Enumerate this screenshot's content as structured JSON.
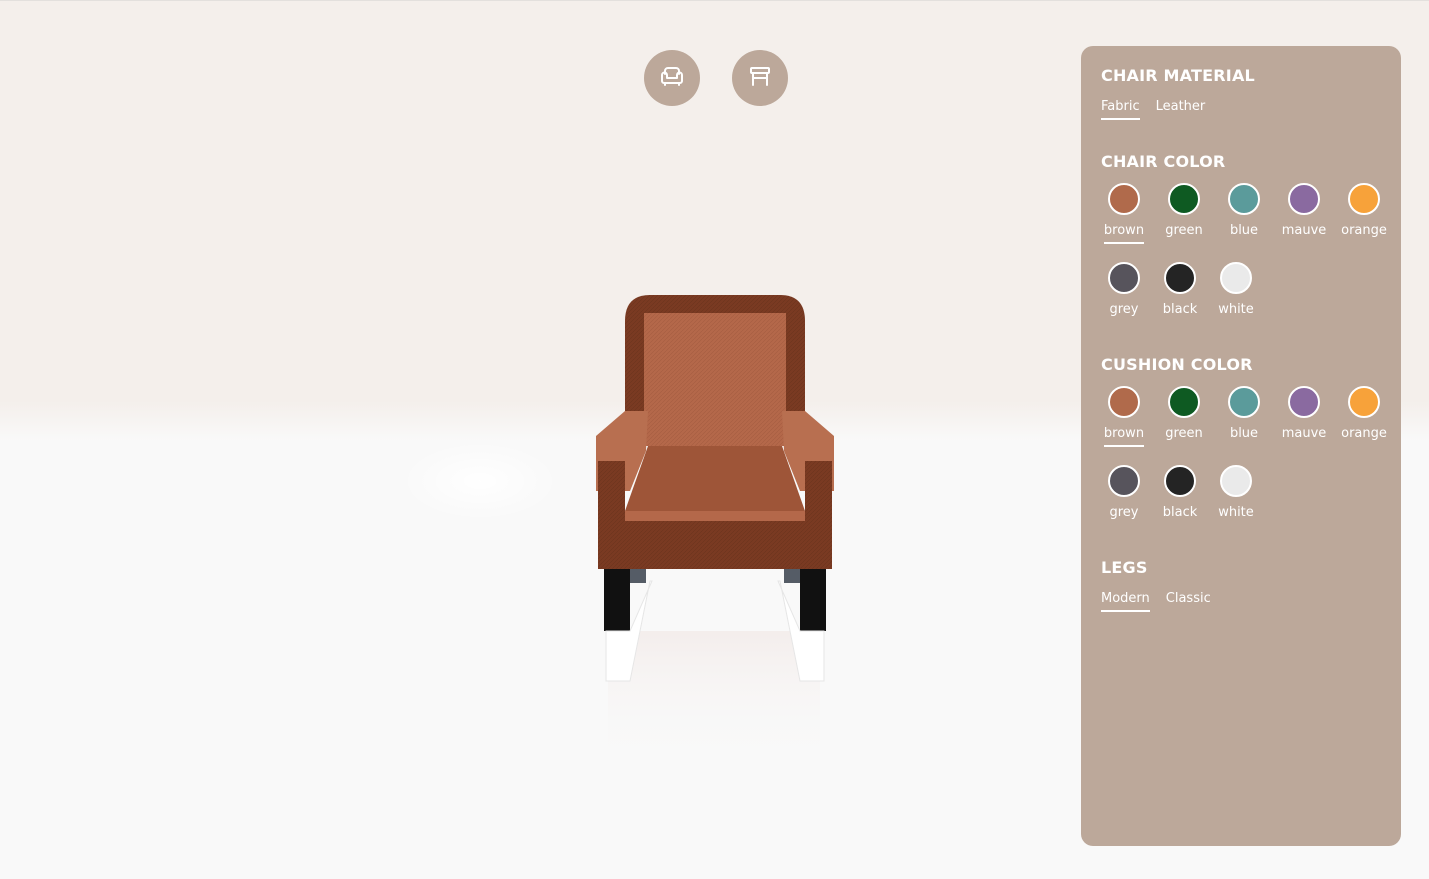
{
  "toolbar": {
    "buttons": [
      {
        "icon": "armchair-icon"
      },
      {
        "icon": "stool-icon"
      }
    ]
  },
  "panel": {
    "chair_material": {
      "title": "CHAIR MATERIAL",
      "options": [
        "Fabric",
        "Leather"
      ],
      "selected": "Fabric"
    },
    "chair_color": {
      "title": "CHAIR COLOR",
      "options": [
        {
          "label": "brown",
          "color": "#b06a4b"
        },
        {
          "label": "green",
          "color": "#0e5a22"
        },
        {
          "label": "blue",
          "color": "#5b9b9b"
        },
        {
          "label": "mauve",
          "color": "#8a6aa0"
        },
        {
          "label": "orange",
          "color": "#f7a23a"
        },
        {
          "label": "grey",
          "color": "#57545c"
        },
        {
          "label": "black",
          "color": "#242424"
        },
        {
          "label": "white",
          "color": "#eaeaea"
        }
      ],
      "selected": "brown"
    },
    "cushion_color": {
      "title": "CUSHION COLOR",
      "options": [
        {
          "label": "brown",
          "color": "#b06a4b"
        },
        {
          "label": "green",
          "color": "#0e5a22"
        },
        {
          "label": "blue",
          "color": "#5b9b9b"
        },
        {
          "label": "mauve",
          "color": "#8a6aa0"
        },
        {
          "label": "orange",
          "color": "#f7a23a"
        },
        {
          "label": "grey",
          "color": "#57545c"
        },
        {
          "label": "black",
          "color": "#242424"
        },
        {
          "label": "white",
          "color": "#eaeaea"
        }
      ],
      "selected": "brown"
    },
    "legs": {
      "title": "LEGS",
      "options": [
        "Modern",
        "Classic"
      ],
      "selected": "Modern"
    }
  },
  "colors": {
    "panel_bg": "#bca89a",
    "chair_frame": "#7a3a22",
    "chair_fabric": "#b4684a",
    "legs": "#111111"
  }
}
